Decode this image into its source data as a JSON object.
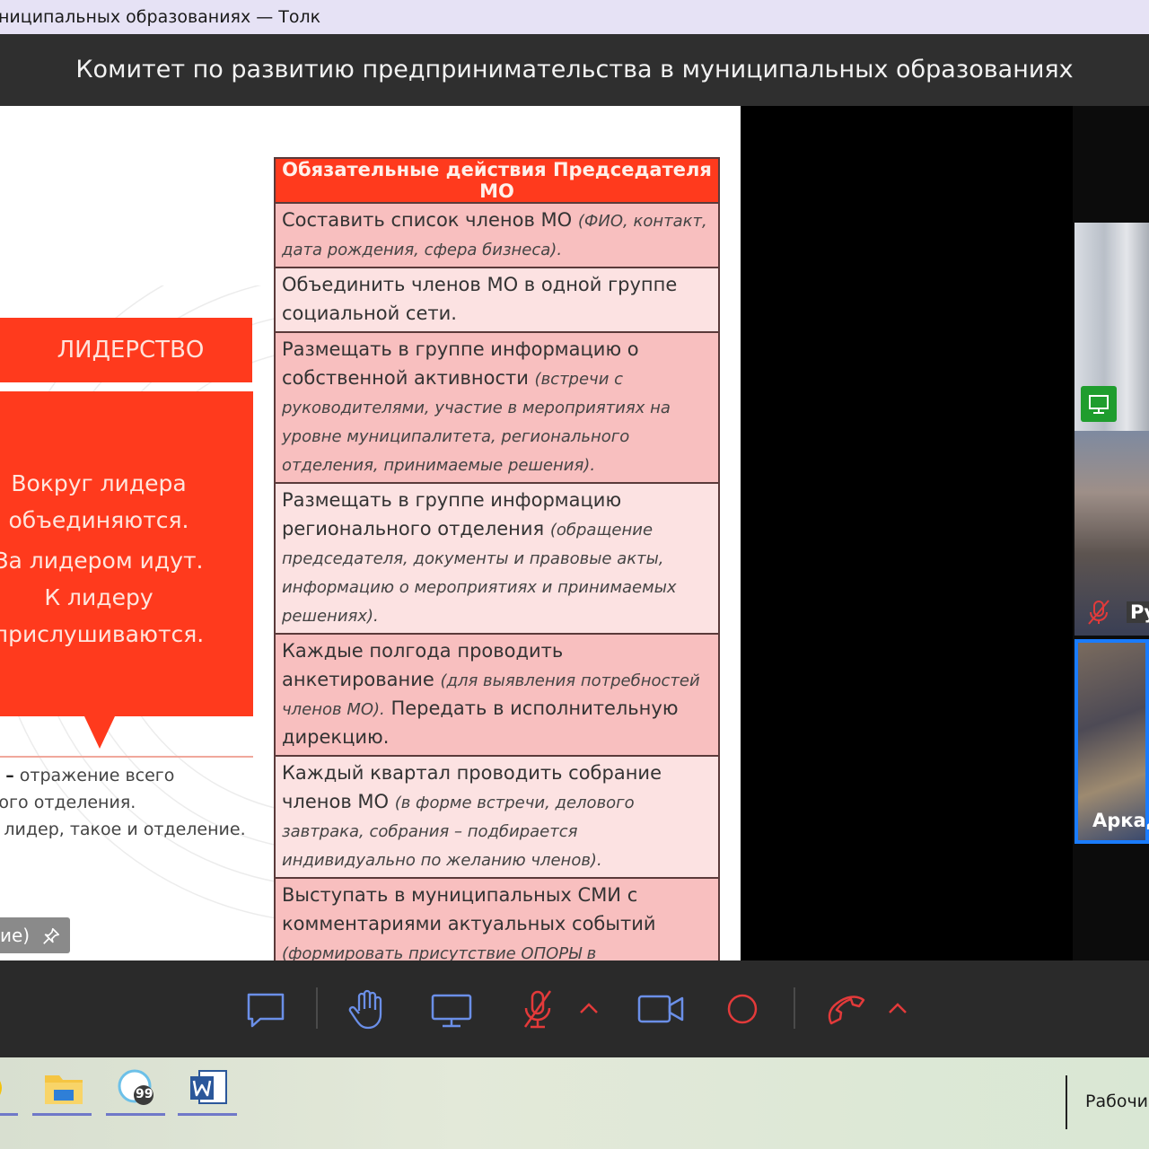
{
  "window": {
    "title": "ниципальных образованиях — Толк",
    "header": "Комитет по развитию предпринимательства в муниципальных образованиях"
  },
  "slide": {
    "leadership_banner": "ЛИДЕРСТВО",
    "leadership_lines": [
      "Вокруг лидера",
      "объединяются.",
      "За лидером идут.",
      "К лидеру",
      "прислушиваются."
    ],
    "note_bold": "р –",
    "note_line1_rest": " отражение всего",
    "note_line2": "ного отделения.",
    "note_line3": "й лидер, такое и отделение.",
    "pin_label": "ие)",
    "table": {
      "header": "Обязательные действия Председателя МО",
      "rows": [
        {
          "text": "Составить список членов МО ",
          "note": "(ФИО, контакт, дата рождения, сфера бизнеса).",
          "tail": ""
        },
        {
          "text": "Объединить членов МО в одной группе социальной сети.",
          "note": "",
          "tail": ""
        },
        {
          "text": "Размещать в группе информацию о собственной активности ",
          "note": "(встречи с руководителями, участие в мероприятиях на уровне муниципалитета, регионального отделения, принимаемые решения).",
          "tail": ""
        },
        {
          "text": "Размещать в группе информацию регионального отделения ",
          "note": "(обращение председателя, документы и правовые акты, информацию о мероприятиях и принимаемых решениях).",
          "tail": ""
        },
        {
          "text": "Каждые полгода проводить анкетирование ",
          "note": "(для выявления потребностей членов МО).",
          "tail": " Передать в исполнительную дирекцию."
        },
        {
          "text": "Каждый квартал проводить собрание членов МО ",
          "note": "(в форме встречи, делового завтрака, собрания – подбирается индивидуально по желанию членов).",
          "tail": ""
        },
        {
          "text": "Выступать в муниципальных СМИ с комментариями актуальных событий ",
          "note": "(формировать присутствие ОПОРЫ в информационном пространстве).",
          "tail": ""
        }
      ]
    }
  },
  "participants": [
    {
      "name": "Ру",
      "muted": true
    },
    {
      "name": "Аркад",
      "active_speaker": true
    }
  ],
  "toolbar": {
    "buttons": [
      "chat",
      "raise-hand",
      "screen-share",
      "microphone-muted",
      "camera",
      "record",
      "hang-up"
    ]
  },
  "taskbar": {
    "apps": [
      "chrome",
      "file-explorer",
      "messenger",
      "word"
    ],
    "messenger_badge": "99",
    "desktop_label": "Рабочи"
  },
  "colors": {
    "accent": "#ff3a1d",
    "row_dark": "#f8bfbf",
    "row_light": "#fce2e2",
    "active_speaker_border": "#1a7cff",
    "mic_icon": "#e33a3a",
    "screen_badge": "#1f9d2e",
    "toolbar_icon": "#6b8fe8"
  }
}
